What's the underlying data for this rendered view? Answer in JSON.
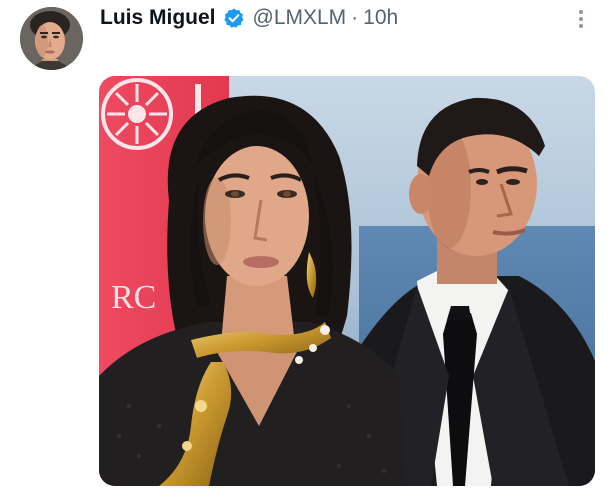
{
  "tweet": {
    "display_name": "Luis Miguel",
    "handle": "@LMXLM",
    "separator": "·",
    "timestamp": "10h",
    "verified_icon": "verified-badge-icon",
    "more_icon": "more-vertical-icon",
    "avatar_label": "avatar",
    "media": {
      "backdrop_text": "RC",
      "description_icon": "photo"
    }
  },
  "colors": {
    "name": "#0f1419",
    "secondary": "#536471",
    "verified": "#1d9bf0",
    "pink_backdrop": "#e8405a",
    "sky": "#b8cde0",
    "ocean": "#5b86b0"
  }
}
